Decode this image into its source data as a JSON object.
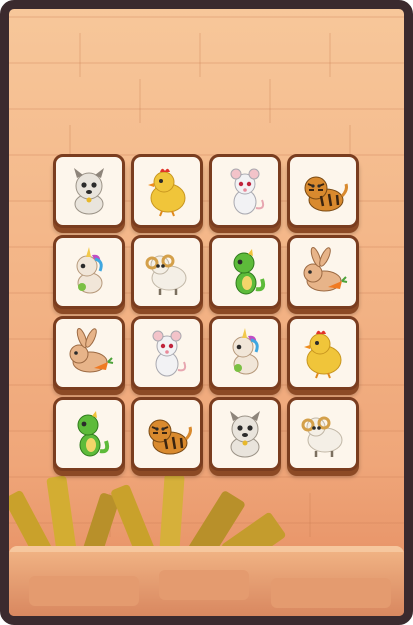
{
  "game": {
    "board": {
      "rows": 4,
      "cols": 4,
      "tiles": [
        {
          "animal": "dog",
          "icon": "dog-icon",
          "color": "#e9e4dc"
        },
        {
          "animal": "chicken",
          "icon": "chicken-icon",
          "color": "#f0c53a"
        },
        {
          "animal": "mouse",
          "icon": "mouse-icon",
          "color": "#f2f2f4"
        },
        {
          "animal": "tiger",
          "icon": "tiger-icon",
          "color": "#d98a2e"
        },
        {
          "animal": "unicorn",
          "icon": "unicorn-icon",
          "color": "#f1e6d8"
        },
        {
          "animal": "sheep",
          "icon": "sheep-icon",
          "color": "#f4efe6"
        },
        {
          "animal": "dragon",
          "icon": "dragon-icon",
          "color": "#5dbb3a"
        },
        {
          "animal": "rabbit",
          "icon": "rabbit-icon",
          "color": "#e7b489"
        },
        {
          "animal": "rabbit",
          "icon": "rabbit-icon",
          "color": "#e7b489"
        },
        {
          "animal": "mouse",
          "icon": "mouse-icon",
          "color": "#f2f2f4"
        },
        {
          "animal": "unicorn",
          "icon": "unicorn-icon",
          "color": "#f1e6d8"
        },
        {
          "animal": "chicken",
          "icon": "chicken-icon",
          "color": "#f0c53a"
        },
        {
          "animal": "dragon",
          "icon": "dragon-icon",
          "color": "#5dbb3a"
        },
        {
          "animal": "tiger",
          "icon": "tiger-icon",
          "color": "#d98a2e"
        },
        {
          "animal": "dog",
          "icon": "dog-icon",
          "color": "#e9e4dc"
        },
        {
          "animal": "sheep",
          "icon": "sheep-icon",
          "color": "#f4efe6"
        }
      ]
    },
    "theme": {
      "frame": "#3b2a2e",
      "tile_face": "#fdf6ec",
      "tile_border": "#7a3d1f",
      "background_top": "#f7c79a",
      "background_bottom": "#e48a5f"
    }
  }
}
